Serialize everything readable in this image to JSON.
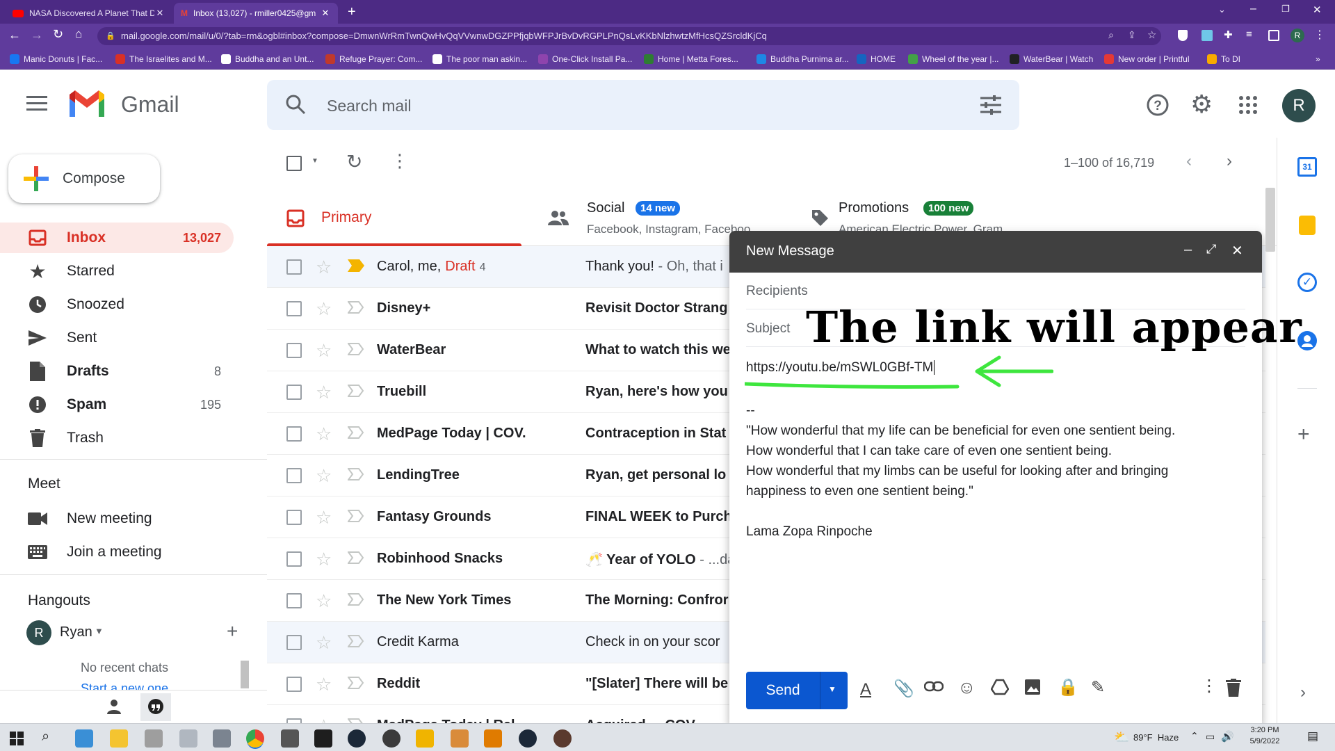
{
  "browser": {
    "tabs": [
      {
        "title": "NASA Discovered A Planet That D",
        "active": false
      },
      {
        "title": "Inbox (13,027) - rmiller0425@gm",
        "active": true
      }
    ],
    "url": "mail.google.com/mail/u/0/?tab=rm&ogbl#inbox?compose=DmwnWrRmTwnQwHvQqVVwnwDGZPPfjqbWFPJrBvDvRGPLPnQsLvKKbNlzhwtzMfHcsQZSrcldKjCq",
    "bookmarks": [
      {
        "label": "Manic Donuts | Fac...",
        "color": "#1877f2"
      },
      {
        "label": "The Israelites and M...",
        "color": "#d93025"
      },
      {
        "label": "Buddha and an Unt...",
        "color": "#ffffff"
      },
      {
        "label": "Refuge Prayer: Com...",
        "color": "#c0392b"
      },
      {
        "label": "The poor man askin...",
        "color": "#ffffff"
      },
      {
        "label": "One-Click Install Pa...",
        "color": "#8e44ad"
      },
      {
        "label": "Home | Metta Fores...",
        "color": "#2e7d32"
      },
      {
        "label": "Buddha Purnima ar...",
        "color": "#1e88e5"
      },
      {
        "label": "HOME",
        "color": "#1565c0"
      },
      {
        "label": "Wheel of the year |...",
        "color": "#43a047"
      },
      {
        "label": "WaterBear | Watch",
        "color": "#202124"
      },
      {
        "label": "New order | Printful",
        "color": "#e53935"
      },
      {
        "label": "To DI",
        "color": "#f9ab00"
      }
    ]
  },
  "gmail": {
    "logo_text": "Gmail",
    "search_placeholder": "Search mail",
    "avatar_letter": "R",
    "compose_label": "Compose",
    "nav": [
      {
        "label": "Inbox",
        "count": "13,027",
        "icon": "inbox-icon"
      },
      {
        "label": "Starred",
        "count": "",
        "icon": "star-icon"
      },
      {
        "label": "Snoozed",
        "count": "",
        "icon": "clock-icon"
      },
      {
        "label": "Sent",
        "count": "",
        "icon": "send-icon"
      },
      {
        "label": "Drafts",
        "count": "8",
        "icon": "draft-icon"
      },
      {
        "label": "Spam",
        "count": "195",
        "icon": "spam-icon"
      },
      {
        "label": "Trash",
        "count": "",
        "icon": "trash-icon"
      }
    ],
    "meet": {
      "title": "Meet",
      "new_meeting": "New meeting",
      "join_meeting": "Join a meeting"
    },
    "hangouts": {
      "title": "Hangouts",
      "user": "Ryan",
      "user_initial": "R",
      "no_chats": "No recent chats",
      "start_new": "Start a new one"
    },
    "pagination": "1–100 of 16,719",
    "categories": [
      {
        "name": "Primary",
        "sub": "",
        "badge": ""
      },
      {
        "name": "Social",
        "sub": "Facebook, Instagram, Faceboo",
        "badge": "14 new"
      },
      {
        "name": "Promotions",
        "sub": "American Electric Power, Gram",
        "badge": "100 new"
      }
    ],
    "emails": [
      {
        "sender": "Carol, me,",
        "draft": "Draft",
        "count": "4",
        "subject": "Thank you!",
        "snippet": " - Oh, that i",
        "unread": false,
        "important": true
      },
      {
        "sender": "Disney+",
        "subject": "Revisit Doctor Strang",
        "snippet": "",
        "unread": true,
        "important": false
      },
      {
        "sender": "WaterBear",
        "subject": "What to watch this we",
        "snippet": "",
        "unread": true,
        "important": false
      },
      {
        "sender": "Truebill",
        "subject": "Ryan, here's how you",
        "snippet": "",
        "unread": true,
        "important": false
      },
      {
        "sender": "MedPage Today | COV.",
        "subject": "Contraception in Stat",
        "snippet": "",
        "unread": true,
        "important": false
      },
      {
        "sender": "LendingTree",
        "subject": "Ryan, get personal lo",
        "snippet": "",
        "unread": true,
        "important": false
      },
      {
        "sender": "Fantasy Grounds",
        "subject": "FINAL WEEK to Purch",
        "snippet": "",
        "unread": true,
        "important": false
      },
      {
        "sender": "Robinhood Snacks",
        "subject": "🥂 Year of YOLO",
        "snippet": " - ...da",
        "unread": true,
        "important": false
      },
      {
        "sender": "The New York Times",
        "subject": "The Morning: Confror",
        "snippet": "",
        "unread": true,
        "important": false
      },
      {
        "sender": "Credit Karma",
        "subject": "Check in on your scor",
        "snippet": "",
        "unread": false,
        "important": false
      },
      {
        "sender": "Reddit",
        "subject": "\"[Slater] There will be",
        "snippet": "",
        "unread": true,
        "important": false
      },
      {
        "sender": "MedPage Today | Rel.",
        "subject": "Acquired ...  COV",
        "snippet": "",
        "unread": true,
        "important": false
      }
    ]
  },
  "compose": {
    "title": "New Message",
    "recipients_placeholder": "Recipients",
    "subject_placeholder": "Subject",
    "overlay_caption": "The link will appear",
    "link": "https://youtu.be/mSWL0GBf-TM",
    "signature_sep": "--",
    "quote": "\"How wonderful that my life can be beneficial for even one sentient being.\nHow wonderful that I can take care of even one sentient being.\nHow wonderful that my limbs can be useful for looking after and bringing\nhappiness to even one sentient being.\"",
    "author": "Lama Zopa Rinpoche",
    "send_label": "Send"
  },
  "taskbar": {
    "weather": "89°F  Haze",
    "time": "3:20 PM",
    "date": "5/9/2022"
  },
  "colors": {
    "chrome": "#5f3b9c",
    "gmail_red": "#d93025",
    "accent_green": "#3ee63e",
    "send_blue": "#0b57d0"
  }
}
